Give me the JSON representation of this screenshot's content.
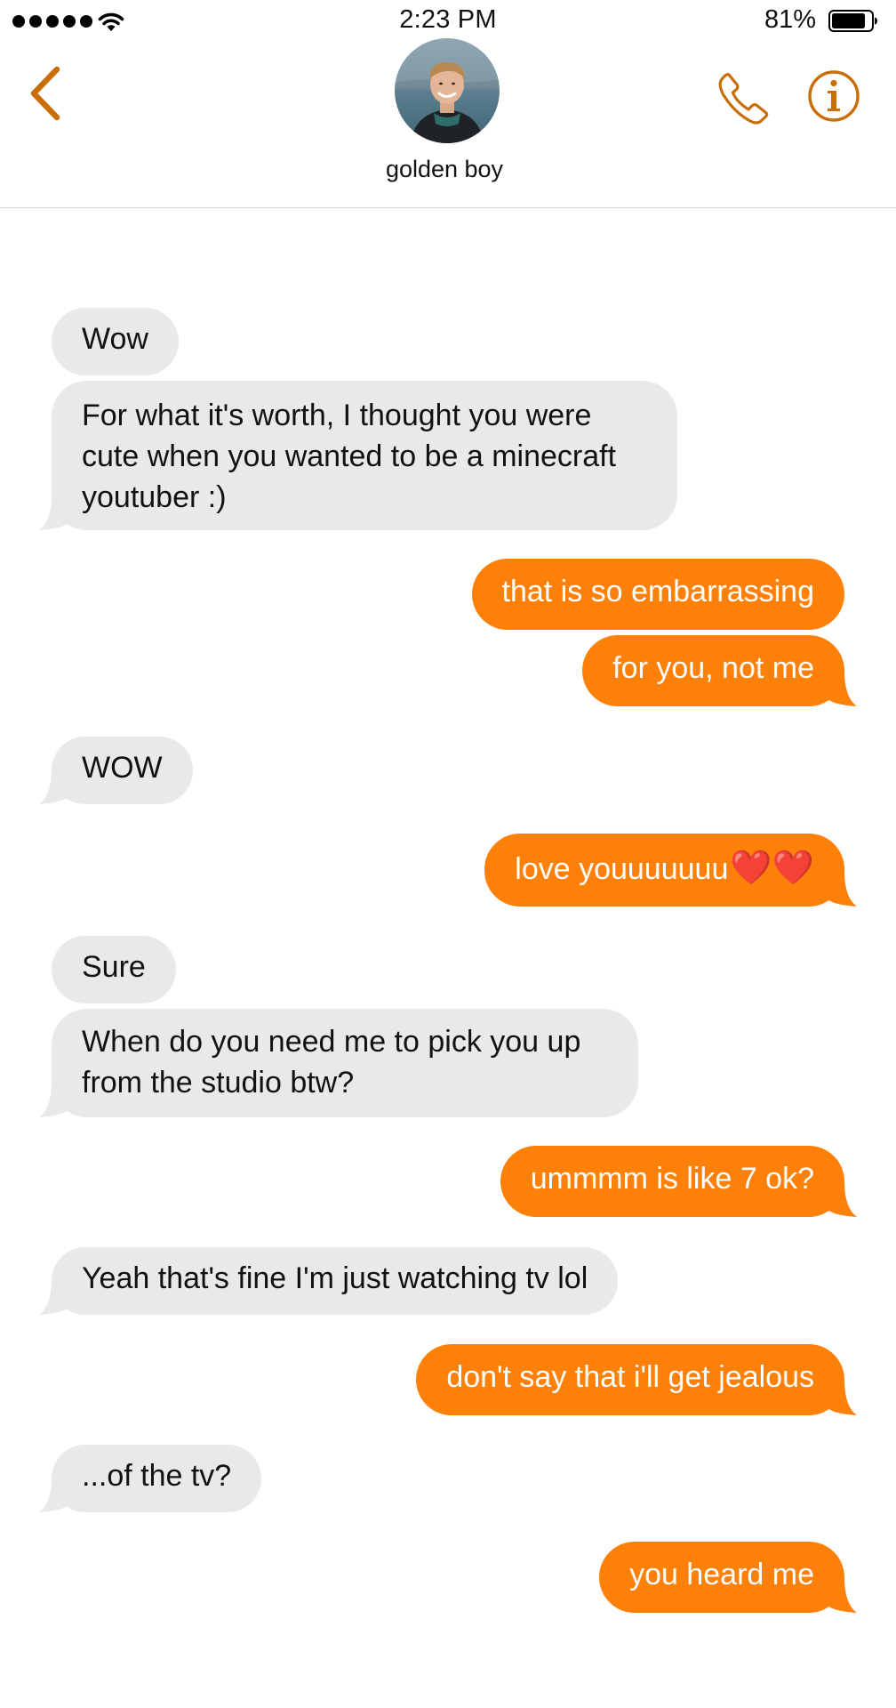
{
  "status_bar": {
    "time": "2:23 PM",
    "battery": "81%"
  },
  "header": {
    "contact_name": "golden boy",
    "accent_color": "#fd8008"
  },
  "icons": {
    "back": "chevron-left-icon",
    "phone": "phone-icon",
    "info": "info-icon"
  },
  "messages": [
    {
      "direction": "in",
      "text": "Wow"
    },
    {
      "direction": "in",
      "text": "For what it's worth, I thought you were cute when you wanted to be a minecraft youtuber :)"
    },
    {
      "direction": "out",
      "text": "that is so embarrassing"
    },
    {
      "direction": "out",
      "text": "for you, not me"
    },
    {
      "direction": "in",
      "text": "WOW"
    },
    {
      "direction": "out",
      "text": "love youuuuuuu",
      "emoji": "❤️❤️"
    },
    {
      "direction": "in",
      "text": "Sure"
    },
    {
      "direction": "in",
      "text": "When do you need me to pick you up from the studio btw?"
    },
    {
      "direction": "out",
      "text": "ummmm is like 7 ok?"
    },
    {
      "direction": "in",
      "text": "Yeah that's fine I'm just watching tv lol"
    },
    {
      "direction": "out",
      "text": "don't say that i'll get jealous"
    },
    {
      "direction": "in",
      "text": "...of the tv?"
    },
    {
      "direction": "out",
      "text": "you heard me"
    }
  ]
}
